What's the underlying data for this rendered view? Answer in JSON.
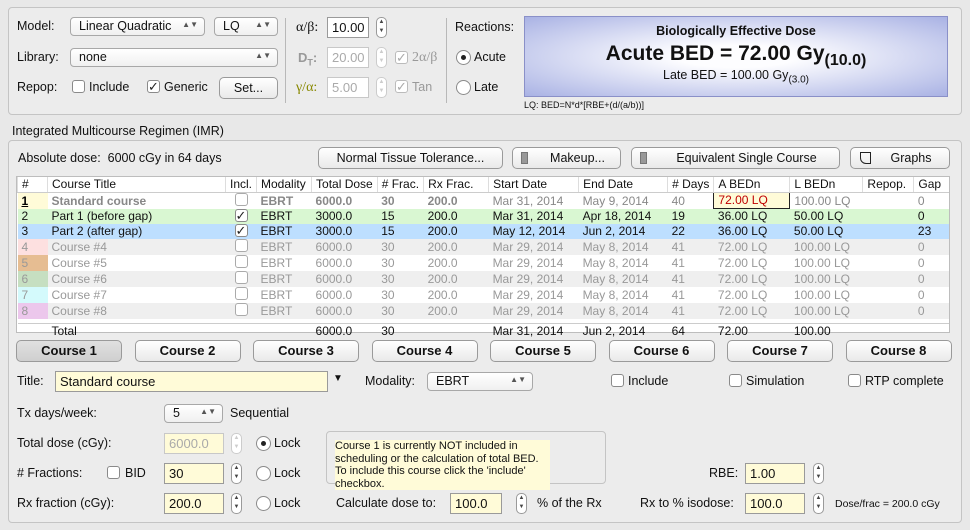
{
  "model": {
    "label": "Model:",
    "value": "Linear Quadratic",
    "variant": "LQ"
  },
  "library": {
    "label": "Library:",
    "value": "none"
  },
  "repop": {
    "label": "Repop:",
    "include_label": "Include",
    "include_checked": false,
    "generic_label": "Generic",
    "generic_checked": true,
    "set_button": "Set..."
  },
  "params": {
    "alpha_beta_label": "α/β:",
    "alpha_beta": "10.00",
    "dt_label": "D",
    "dt_sub": "T",
    "dt_colon": ":",
    "dt": "20.00",
    "two_ab_label": "2α/β",
    "gamma_alpha_label": "γ/α:",
    "gamma_alpha": "5.00",
    "tan_label": "Tan"
  },
  "reactions": {
    "label": "Reactions:",
    "acute": "Acute",
    "late": "Late",
    "selected": "Acute"
  },
  "bed": {
    "title": "Biologically Effective Dose",
    "acute": "Acute BED = 72.00 Gy",
    "acute_sub": "(10.0)",
    "late": "Late BED = 100.00 Gy",
    "late_sub": "(3.0)",
    "formula": "LQ: BED=N*d*[RBE+(d/(a/b))]"
  },
  "imr": {
    "section_title": "Integrated Multicourse Regimen (IMR)",
    "absolute_dose_label": "Absolute dose:",
    "absolute_dose": "6000 cGy in 64 days",
    "buttons": {
      "ntt": "Normal Tissue Tolerance...",
      "makeup": "Makeup...",
      "esc": "Equivalent Single Course",
      "graphs": "Graphs"
    }
  },
  "table": {
    "columns": [
      "#",
      "Course Title",
      "Incl.",
      "Modality",
      "Total Dose",
      "# Frac.",
      "Rx Frac.",
      "Start Date",
      "End Date",
      "# Days",
      "A BEDn",
      "L BEDn",
      "Repop.",
      "Gap"
    ],
    "rows": [
      {
        "num": "1",
        "color": "#fffbd8",
        "title": "Standard course",
        "incl": false,
        "modality": "EBRT",
        "total": "6000.0",
        "frac": "30",
        "rx": "200.0",
        "start": "Mar 31, 2014",
        "end": "May 9, 2014",
        "days": "40",
        "abed": "72.00  LQ",
        "lbed": "100.00  LQ",
        "repop": "",
        "gap": "0"
      },
      {
        "num": "2",
        "color": "#d9f7d2",
        "title": "Part 1 (before gap)",
        "incl": true,
        "modality": "EBRT",
        "total": "3000.0",
        "frac": "15",
        "rx": "200.0",
        "start": "Mar 31, 2014",
        "end": "Apr 18, 2014",
        "days": "19",
        "abed": "36.00  LQ",
        "lbed": "50.00  LQ",
        "repop": "",
        "gap": "0"
      },
      {
        "num": "3",
        "color": "#bddfff",
        "title": "Part 2 (after gap)",
        "incl": true,
        "modality": "EBRT",
        "total": "3000.0",
        "frac": "15",
        "rx": "200.0",
        "start": "May 12, 2014",
        "end": "Jun 2, 2014",
        "days": "22",
        "abed": "36.00  LQ",
        "lbed": "50.00  LQ",
        "repop": "",
        "gap": "23"
      },
      {
        "num": "4",
        "color": "#fde0e0",
        "title": "Course #4",
        "incl": false,
        "modality": "EBRT",
        "total": "6000.0",
        "frac": "30",
        "rx": "200.0",
        "start": "Mar 29, 2014",
        "end": "May 8, 2014",
        "days": "41",
        "abed": "72.00  LQ",
        "lbed": "100.00  LQ",
        "repop": "",
        "gap": "0"
      },
      {
        "num": "5",
        "color": "#e6bd92",
        "title": "Course #5",
        "incl": false,
        "modality": "EBRT",
        "total": "6000.0",
        "frac": "30",
        "rx": "200.0",
        "start": "Mar 29, 2014",
        "end": "May 8, 2014",
        "days": "41",
        "abed": "72.00  LQ",
        "lbed": "100.00  LQ",
        "repop": "",
        "gap": "0"
      },
      {
        "num": "6",
        "color": "#c6dfc1",
        "title": "Course #6",
        "incl": false,
        "modality": "EBRT",
        "total": "6000.0",
        "frac": "30",
        "rx": "200.0",
        "start": "Mar 29, 2014",
        "end": "May 8, 2014",
        "days": "41",
        "abed": "72.00  LQ",
        "lbed": "100.00  LQ",
        "repop": "",
        "gap": "0"
      },
      {
        "num": "7",
        "color": "#d4fafc",
        "title": "Course #7",
        "incl": false,
        "modality": "EBRT",
        "total": "6000.0",
        "frac": "30",
        "rx": "200.0",
        "start": "Mar 29, 2014",
        "end": "May 8, 2014",
        "days": "41",
        "abed": "72.00  LQ",
        "lbed": "100.00  LQ",
        "repop": "",
        "gap": "0"
      },
      {
        "num": "8",
        "color": "#ecc7ec",
        "title": "Course #8",
        "incl": false,
        "modality": "EBRT",
        "total": "6000.0",
        "frac": "30",
        "rx": "200.0",
        "start": "Mar 29, 2014",
        "end": "May 8, 2014",
        "days": "41",
        "abed": "72.00  LQ",
        "lbed": "100.00  LQ",
        "repop": "",
        "gap": "0"
      }
    ],
    "total": {
      "label": "Total",
      "total": "6000.0",
      "frac": "30",
      "start": "Mar 31, 2014",
      "end": "Jun 2, 2014",
      "days": "64",
      "abed": "72.00",
      "lbed": "100.00"
    }
  },
  "course_tabs": [
    "Course 1",
    "Course 2",
    "Course 3",
    "Course 4",
    "Course 5",
    "Course 6",
    "Course 7",
    "Course 8"
  ],
  "course_tab_selected": "Course 1",
  "course": {
    "title_label": "Title:",
    "title": "Standard course",
    "modality_label": "Modality:",
    "modality": "EBRT",
    "include_label": "Include",
    "simulation_label": "Simulation",
    "rtp_label": "RTP complete",
    "tx_days_label": "Tx days/week:",
    "tx_days": "5",
    "sequential": "Sequential",
    "total_dose_label": "Total dose (cGy):",
    "total_dose": "6000.0",
    "fractions_label": "# Fractions:",
    "bid_label": "BID",
    "fractions": "30",
    "rx_fraction_label": "Rx fraction (cGy):",
    "rx_fraction": "200.0",
    "lock_label": "Lock",
    "lock_selected": "total_dose",
    "note": "Course 1 is currently NOT included in scheduling or the calculation of total BED. To include this course click the 'include' checkbox.",
    "rbe_label": "RBE:",
    "rbe": "1.00",
    "calc_label": "Calculate dose to:",
    "calc": "100.0",
    "calc_suffix": "% of the Rx",
    "isodose_label": "Rx to % isodose:",
    "isodose": "100.0",
    "dose_frac": "Dose/frac = 200.0 cGy"
  }
}
